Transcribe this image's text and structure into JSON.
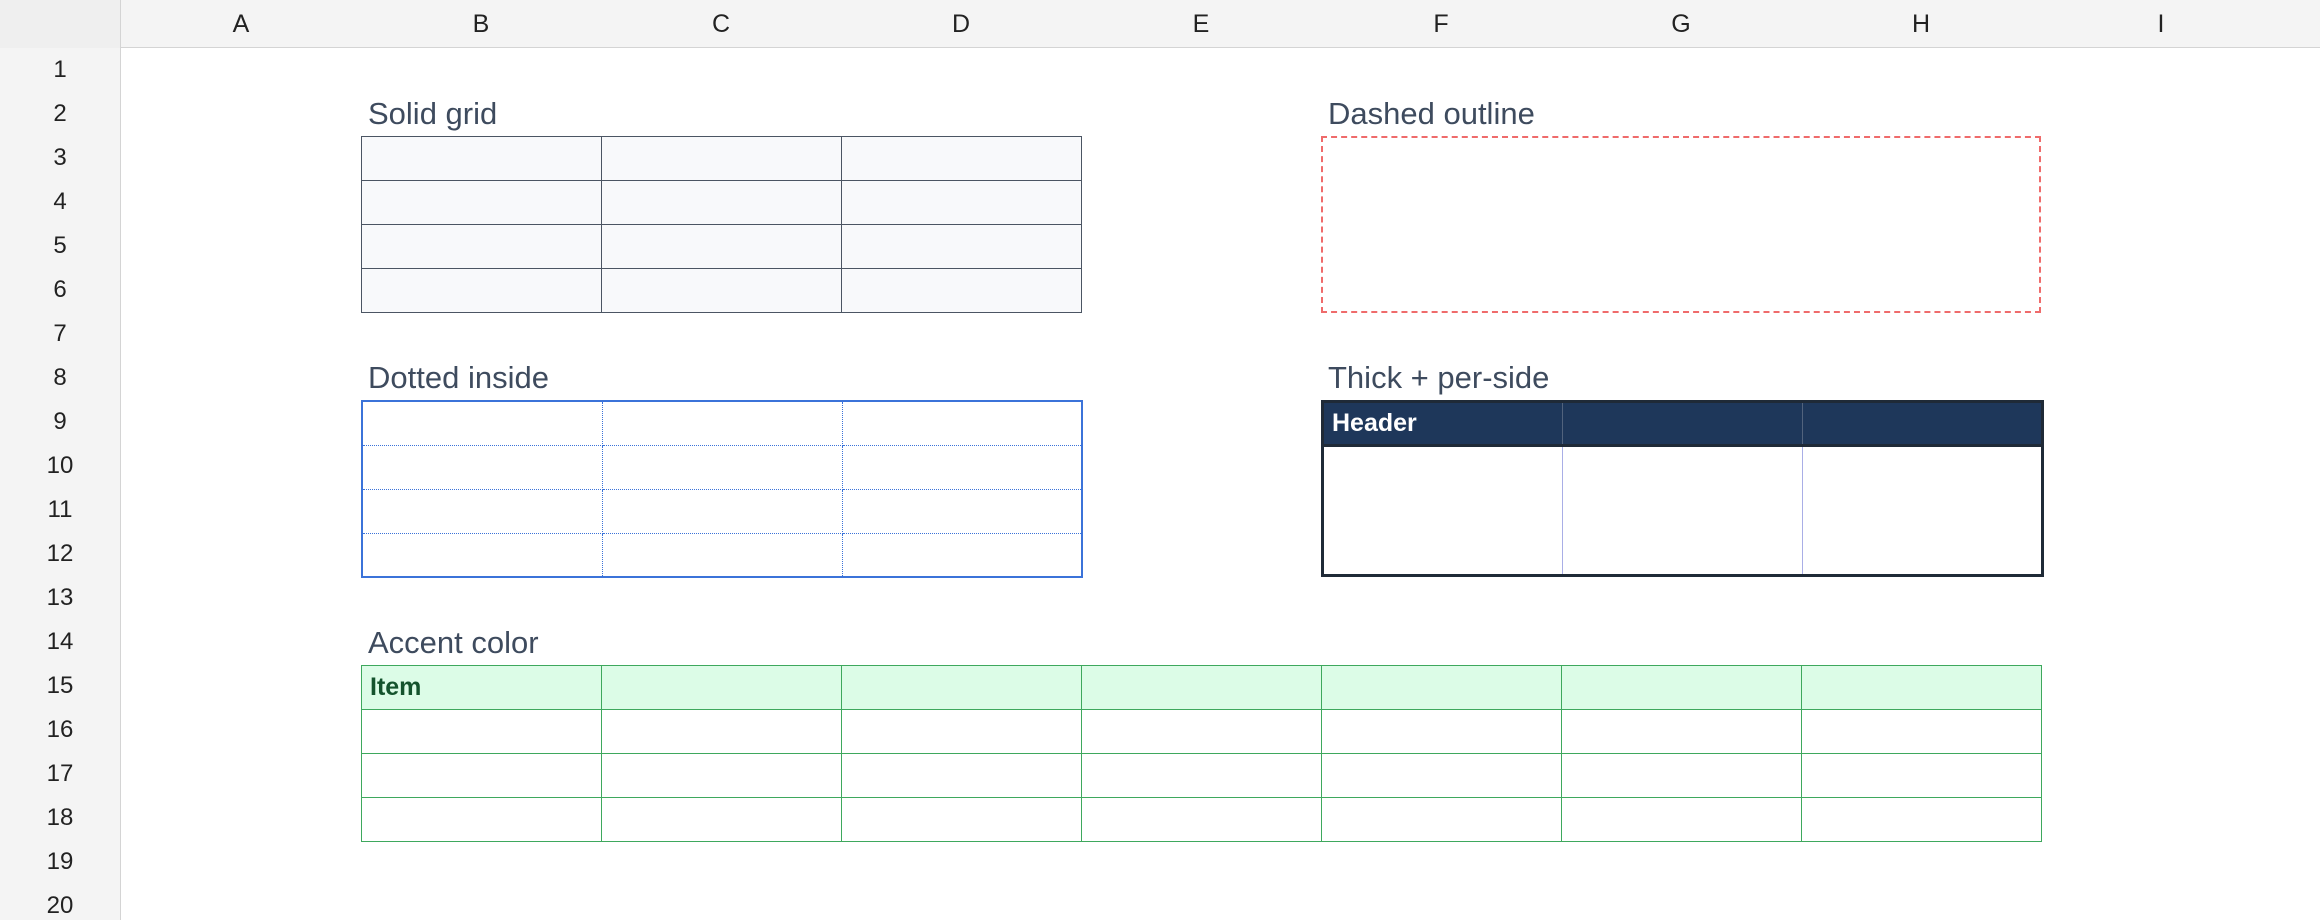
{
  "columns": [
    "A",
    "B",
    "C",
    "D",
    "E",
    "F",
    "G",
    "H",
    "I"
  ],
  "rows": [
    "1",
    "2",
    "3",
    "4",
    "5",
    "6",
    "7",
    "8",
    "9",
    "10",
    "11",
    "12",
    "13",
    "14",
    "15",
    "16",
    "17",
    "18",
    "19",
    "20"
  ],
  "sections": {
    "solid_grid": {
      "title": "Solid grid"
    },
    "dashed_outline": {
      "title": "Dashed outline"
    },
    "dotted_inside": {
      "title": "Dotted inside"
    },
    "thick_per_side": {
      "title": "Thick + per-side",
      "header_label": "Header"
    },
    "accent_color": {
      "title": "Accent color",
      "header_label": "Item"
    }
  },
  "colors": {
    "solid_border": "#4b5563",
    "dashed_border": "#ef6b6b",
    "dotted_border": "#3b73d9",
    "thick_header_bg": "#1e375a",
    "accent_border": "#3ea85d",
    "accent_header_bg": "#dcfce7",
    "accent_header_text": "#14532d"
  }
}
